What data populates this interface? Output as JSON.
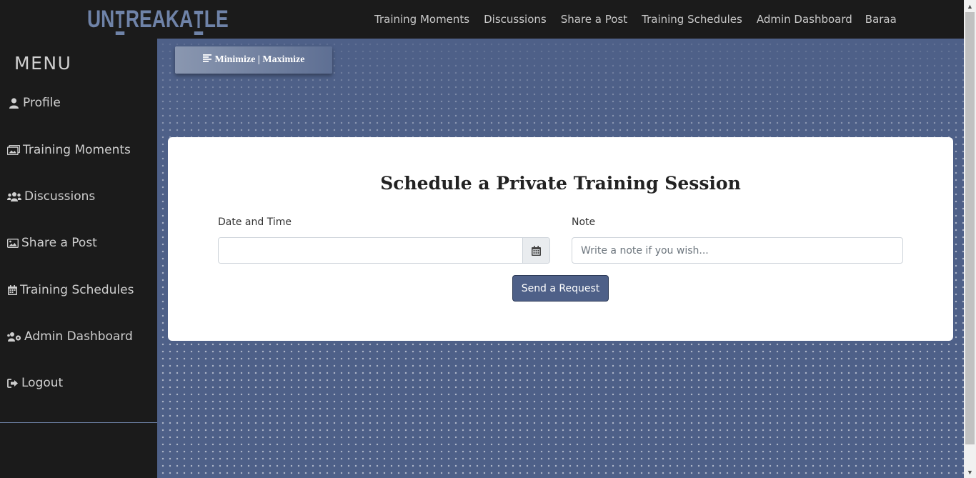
{
  "brand": {
    "logo_text_1": "UN",
    "logo_text_2": "REAKA",
    "logo_text_3": "LE"
  },
  "topnav": {
    "items": [
      {
        "label": "Training Moments"
      },
      {
        "label": "Discussions"
      },
      {
        "label": "Share a Post"
      },
      {
        "label": "Training Schedules"
      },
      {
        "label": "Admin Dashboard"
      }
    ],
    "user": "Baraa"
  },
  "sidebar": {
    "title": "MENU",
    "items": [
      {
        "label": "Profile",
        "icon": "user-icon"
      },
      {
        "label": "Training Moments",
        "icon": "images-icon"
      },
      {
        "label": "Discussions",
        "icon": "users-icon"
      },
      {
        "label": "Share a Post",
        "icon": "image-icon"
      },
      {
        "label": "Training Schedules",
        "icon": "calendar-icon"
      },
      {
        "label": "Admin Dashboard",
        "icon": "users-cog-icon"
      },
      {
        "label": "Logout",
        "icon": "sign-out-icon"
      }
    ]
  },
  "toolbar": {
    "minmax_label": "Minimize | Maximize"
  },
  "form": {
    "title": "Schedule a Private Training Session",
    "date_label": "Date and Time",
    "date_value": "",
    "note_label": "Note",
    "note_value": "",
    "note_placeholder": "Write a note if you wish...",
    "submit_label": "Send a Request"
  },
  "colors": {
    "accent": "#4e6088",
    "logo": "#6f83a8",
    "nav_bg": "#1b1b1b"
  }
}
